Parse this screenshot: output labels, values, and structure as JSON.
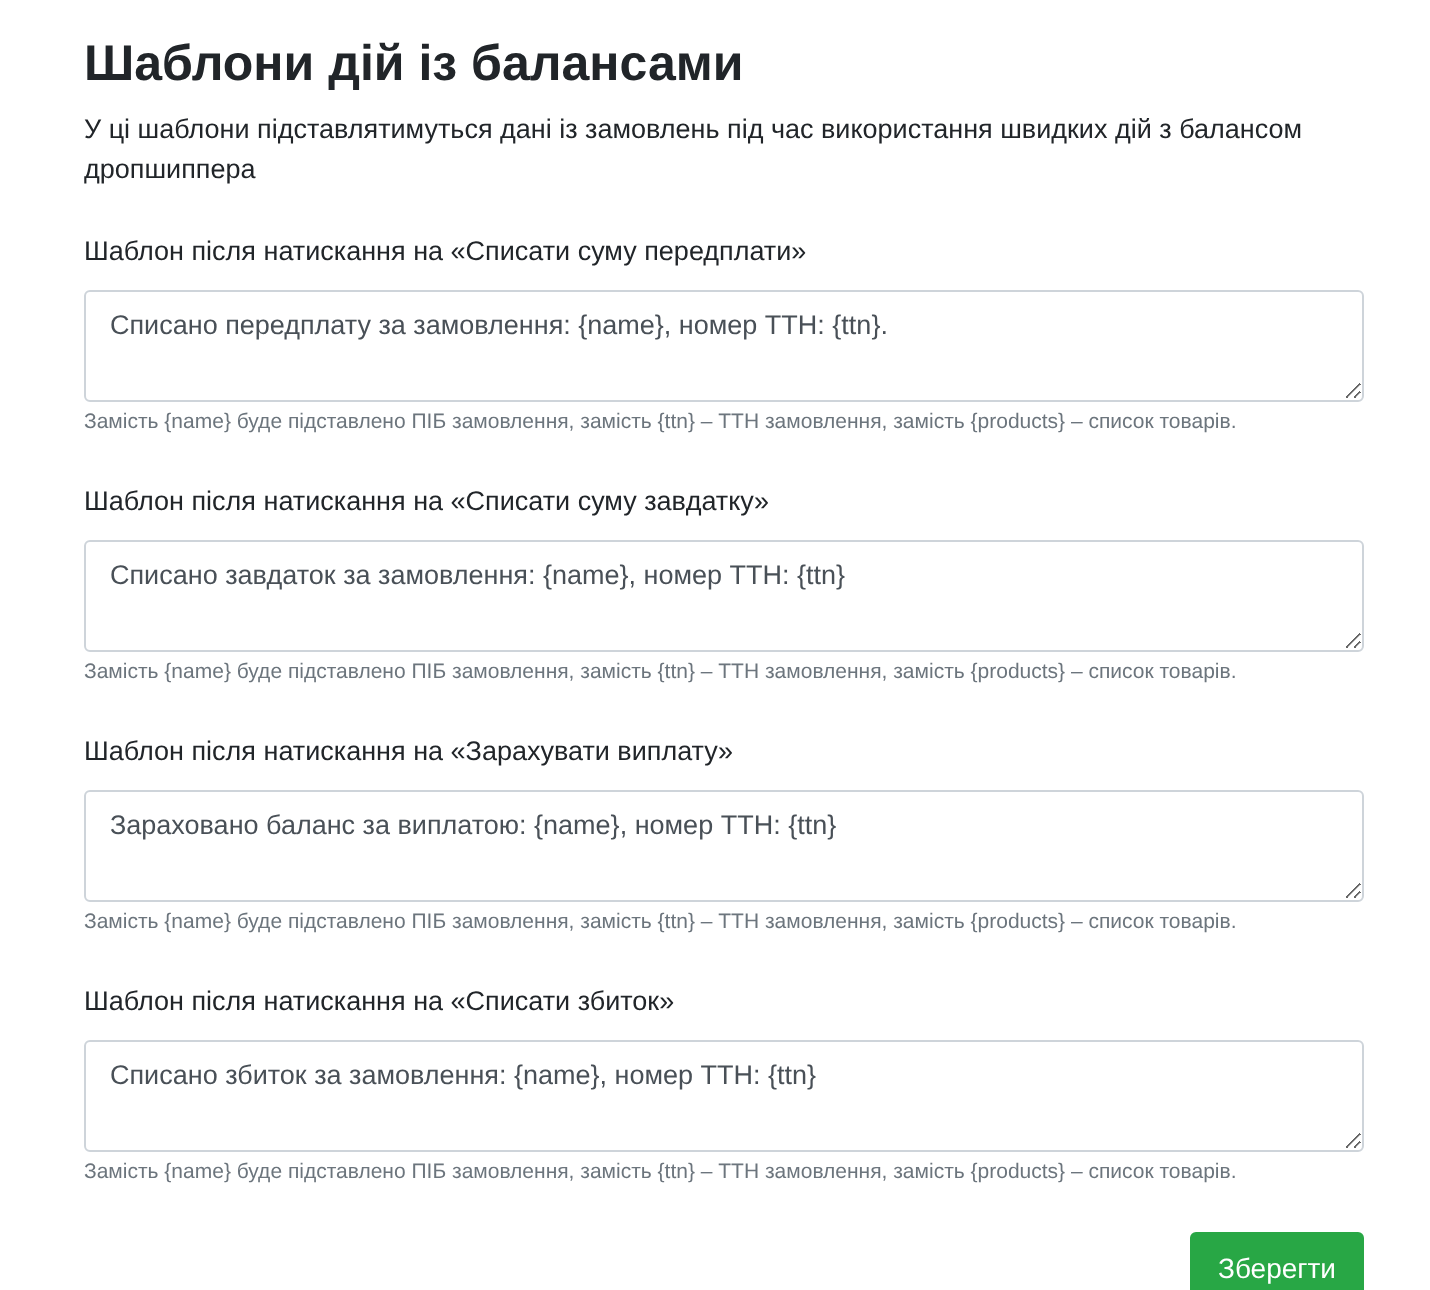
{
  "title": "Шаблони дій із балансами",
  "description": "У ці шаблони підставлятимуться дані із замовлень під час використання швидких дій з балансом дропшиппера",
  "templates": [
    {
      "label": "Шаблон після натискання на «Списати суму передплати»",
      "value": "Списано передплату за замовлення: {name}, номер ТТН: {ttn}.",
      "help": "Замість {name} буде підставлено ПІБ замовлення, замість {ttn} – ТТН замовлення, замість {products} – список товарів."
    },
    {
      "label": "Шаблон після натискання на «Списати суму завдатку»",
      "value": "Списано завдаток за замовлення: {name}, номер ТТН: {ttn}",
      "help": "Замість {name} буде підставлено ПІБ замовлення, замість {ttn} – ТТН замовлення, замість {products} – список товарів."
    },
    {
      "label": "Шаблон після натискання на «Зарахувати виплату»",
      "value": "Зараховано баланс за виплатою: {name}, номер ТТН: {ttn}",
      "help": "Замість {name} буде підставлено ПІБ замовлення, замість {ttn} – ТТН замовлення, замість {products} – список товарів."
    },
    {
      "label": "Шаблон після натискання на «Списати збиток»",
      "value": "Списано збиток за замовлення: {name}, номер ТТН: {ttn}",
      "help": "Замість {name} буде підставлено ПІБ замовлення, замість {ttn} – ТТН замовлення, замість {products} – список товарів."
    }
  ],
  "save_button": "Зберегти"
}
